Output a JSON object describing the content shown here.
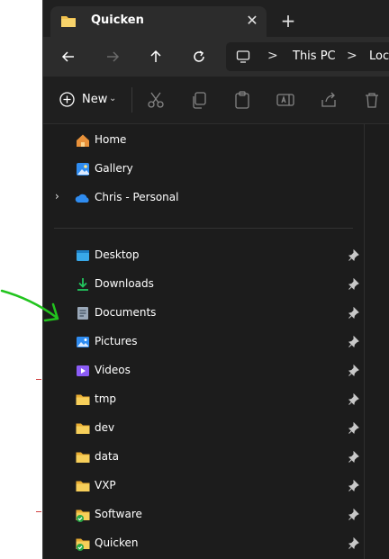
{
  "window": {
    "tab": {
      "title": "Quicken",
      "icon": "folder-icon",
      "close_glyph": "✕"
    },
    "new_tab_glyph": "+"
  },
  "navigation": {
    "back_icon": "arrow-left-icon",
    "forward_icon": "arrow-right-icon",
    "up_icon": "arrow-up-icon",
    "refresh_icon": "refresh-icon",
    "address": {
      "icon": "monitor-icon",
      "separator": ">",
      "segments": [
        "This PC",
        "Loca"
      ]
    }
  },
  "commandbar": {
    "new_label": "New",
    "new_caret": "⌄",
    "icons": [
      "cut-icon",
      "copy-icon",
      "paste-icon",
      "rename-icon",
      "share-icon",
      "delete-icon"
    ]
  },
  "sidebar": {
    "top_items": [
      {
        "label": "Home",
        "icon": "home-icon"
      },
      {
        "label": "Gallery",
        "icon": "gallery-icon"
      },
      {
        "label": "Chris - Personal",
        "icon": "onedrive-cloud-icon",
        "expander": "›"
      }
    ],
    "pinned_items": [
      {
        "label": "Desktop",
        "icon": "desktop-icon",
        "pinned": true
      },
      {
        "label": "Downloads",
        "icon": "downloads-icon",
        "pinned": true
      },
      {
        "label": "Documents",
        "icon": "documents-icon",
        "pinned": true
      },
      {
        "label": "Pictures",
        "icon": "pictures-icon",
        "pinned": true
      },
      {
        "label": "Videos",
        "icon": "videos-icon",
        "pinned": true
      },
      {
        "label": "tmp",
        "icon": "folder-icon",
        "pinned": true
      },
      {
        "label": "dev",
        "icon": "folder-icon",
        "pinned": true
      },
      {
        "label": "data",
        "icon": "folder-icon",
        "pinned": true
      },
      {
        "label": "VXP",
        "icon": "folder-icon",
        "pinned": true
      },
      {
        "label": "Software",
        "icon": "synced-folder-icon",
        "pinned": true
      },
      {
        "label": "Quicken",
        "icon": "synced-folder-icon",
        "pinned": true
      }
    ]
  },
  "colors": {
    "window_bg": "#1c1c1c",
    "tab_bg": "#2c2c2c",
    "folder_yellow": "#f2c14e",
    "onedrive_blue": "#2f8cf0",
    "download_green": "#22c55e",
    "sync_green": "#28a745",
    "annotation_green": "#22c41e"
  }
}
